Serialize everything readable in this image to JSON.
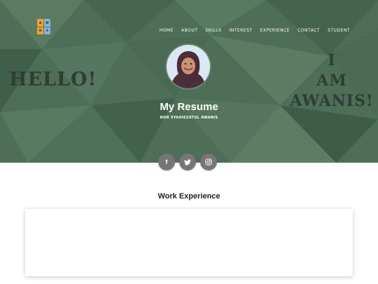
{
  "logo": {
    "letters": [
      "A",
      "W",
      "N",
      "S"
    ],
    "colors": [
      "#f0a033",
      "#7fb6d9",
      "#f0a033",
      "#7fb6d9"
    ]
  },
  "nav": {
    "items": [
      "HOME",
      "ABOUT",
      "SKILLS",
      "INTEREST",
      "EXPERIENCE",
      "CONTACT",
      "STUDENT"
    ]
  },
  "hero": {
    "hello": "HELLO!",
    "iam_lines": [
      "I",
      "AM",
      "AWANIS!"
    ],
    "title": "My Resume",
    "subtitle": "NOR SYAHIEZATUL AWANIS",
    "colors": {
      "background": "#4e6e57",
      "headline": "#2f3d37"
    }
  },
  "social": {
    "items": [
      {
        "icon": "facebook-icon",
        "glyph": "f"
      },
      {
        "icon": "twitter-icon",
        "glyph": "🐦"
      },
      {
        "icon": "instagram-icon",
        "glyph": "◎"
      }
    ]
  },
  "section": {
    "title": "Work Experience"
  }
}
